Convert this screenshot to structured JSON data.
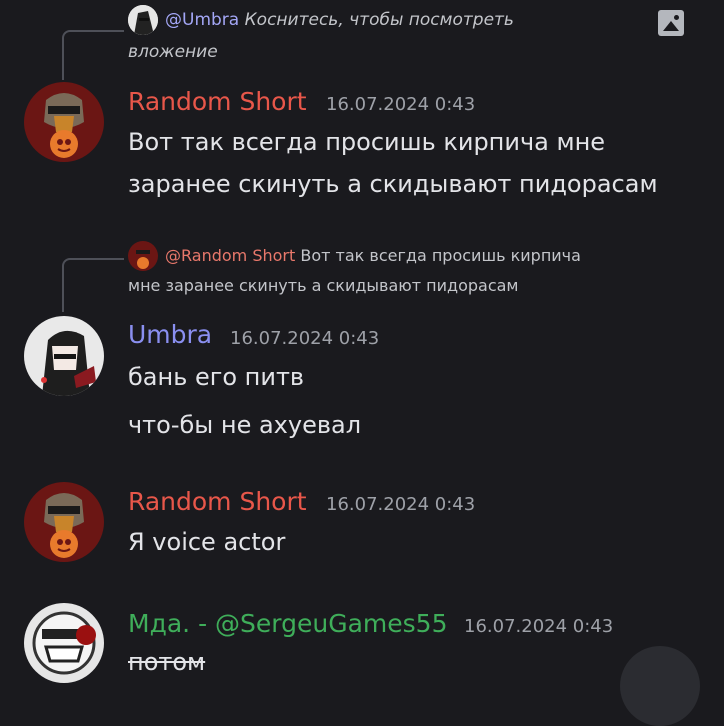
{
  "messages": [
    {
      "reply": {
        "mention": "@Umbra",
        "text_line1": "Коснитесь, чтобы посмотреть",
        "text_line2": "вложение"
      },
      "author": "Random Short",
      "timestamp": "16.07.2024 0:43",
      "lines": [
        "Вот так всегда просишь кирпича мне",
        "заранее скинуть а скидывают пидорасам"
      ]
    },
    {
      "reply": {
        "mention": "@Random Short",
        "text_line1": "Вот так всегда просишь кирпича",
        "text_line2": "мне заранее скинуть а скидывают пидорасам"
      },
      "author": "Umbra",
      "timestamp": "16.07.2024 0:43",
      "lines": [
        "бань его питв",
        "что-бы не ахуевал"
      ]
    },
    {
      "author": "Random Short",
      "timestamp": "16.07.2024 0:43",
      "lines": [
        "Я voice actor"
      ]
    },
    {
      "author": "Мда. - @SergeuGames55",
      "timestamp": "16.07.2024 0:43",
      "lines": [
        "потом"
      ]
    }
  ],
  "colors": {
    "background": "#1a1a1e",
    "random_short": "#e8574a",
    "umbra": "#8a8ff0",
    "sergeu": "#3fae5a",
    "mention": "#a3a6f5"
  },
  "icons": {
    "attachment": "image-icon"
  }
}
